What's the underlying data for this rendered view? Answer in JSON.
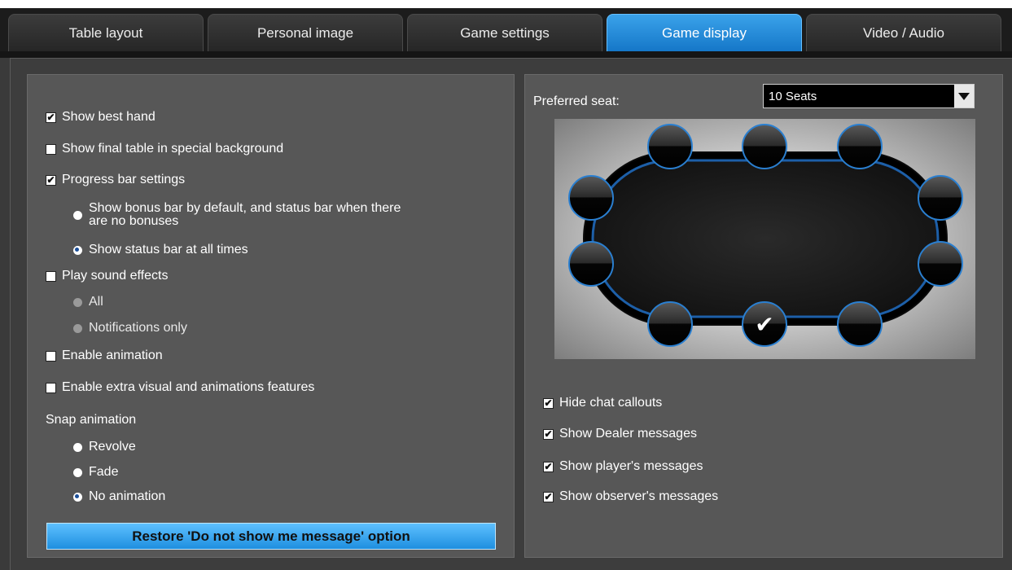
{
  "tabs": [
    {
      "label": "Table layout",
      "active": false
    },
    {
      "label": "Personal image",
      "active": false
    },
    {
      "label": "Game settings",
      "active": false
    },
    {
      "label": "Game display",
      "active": true
    },
    {
      "label": "Video / Audio",
      "active": false
    }
  ],
  "left": {
    "show_best_hand": {
      "label": "Show best hand",
      "checked": true
    },
    "show_final_table": {
      "label": "Show final table in special background",
      "checked": false
    },
    "progress_bar": {
      "label": "Progress bar settings",
      "checked": true
    },
    "bonus_bar_line1": "Show bonus bar by default, and status bar when there",
    "bonus_bar_line2": "are no bonuses",
    "status_bar": "Show status bar at all times",
    "play_sound": {
      "label": "Play sound effects",
      "checked": false
    },
    "sound_all": "All",
    "sound_notifications": "Notifications only",
    "enable_animation": {
      "label": "Enable animation",
      "checked": false
    },
    "extra_visual": {
      "label": "Enable extra visual and animations features",
      "checked": false
    },
    "snap_animation_title": "Snap animation",
    "snap_revolve": "Revolve",
    "snap_fade": "Fade",
    "snap_none": "No animation",
    "selected_snap": "No animation",
    "restore_button": "Restore 'Do not show me message' option"
  },
  "right": {
    "preferred_seat_label": "Preferred seat:",
    "seat_select_value": "10 Seats",
    "selected_seat": "bottom-middle",
    "hide_chat_callouts": {
      "label": "Hide chat callouts",
      "checked": true
    },
    "show_dealer": {
      "label": "Show Dealer messages",
      "checked": true
    },
    "show_player": {
      "label": "Show player's messages",
      "checked": true
    },
    "show_observer": {
      "label": "Show observer's messages",
      "checked": true
    }
  },
  "colors": {
    "accent": "#1e8fe0",
    "tab_active": "#2a8fdc",
    "panel": "#575757",
    "seat_ring": "#2a7fd0"
  }
}
